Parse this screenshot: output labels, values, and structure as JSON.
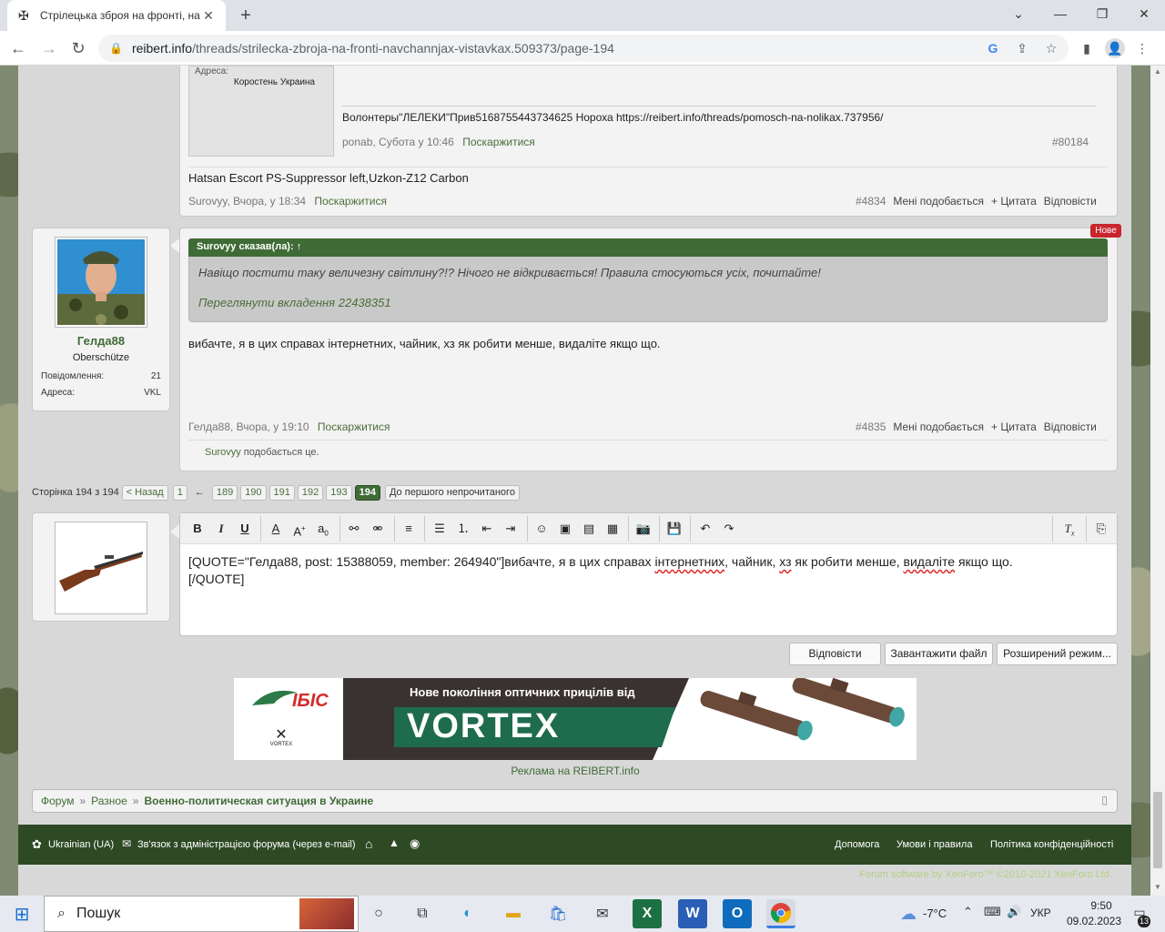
{
  "browser": {
    "tab_title": "Стрілецька зброя на фронті, нав",
    "url_host": "reibert.info",
    "url_path": "/threads/strilecka-zbroja-na-fronti-navchannjax-vistavkax.509373/page-194"
  },
  "prev_post": {
    "address_label": "Адреса:",
    "address_value": "Коростень Украина",
    "signature": "Волонтеры\"ЛЕЛЕКИ\"Прив5168755443734625 Нороха https://reibert.info/threads/pomosch-na-nolikax.737956/",
    "author_time": "ponab, Субота у 10:46",
    "report": "Поскаржитися",
    "number": "#80184",
    "message": "Hatsan Escort PS-Suppressor left,Uzkon-Z12 Carbon",
    "outer_author_time": "Surovyy, Вчора, у 18:34",
    "outer_report": "Поскаржитися",
    "outer_number": "#4834",
    "like": "Мені подобається",
    "quote": "+ Цитата",
    "reply": "Відповісти"
  },
  "post": {
    "badge_new": "Нове",
    "username": "Гелда88",
    "rank": "Oberschütze",
    "messages_label": "Повідомлення:",
    "messages_value": "21",
    "address_label": "Адреса:",
    "address_value": "VKL",
    "quote_header": "Surovyy сказав(ла): ↑",
    "quote_text": "Навіщо постити таку величезну світлину?!? Нічого не відкривається! Правила стосуються усіх, почитайте!",
    "quote_attachment": "Переглянути вкладення 22438351",
    "message": "вибачте, я в цих справах інтернетних, чайник, хз як робити менше, видаліте якщо що.",
    "author_time": "Гелда88, Вчора, у 19:10",
    "report": "Поскаржитися",
    "number": "#4835",
    "like": "Мені подобається",
    "quote": "+ Цитата",
    "reply": "Відповісти",
    "liked_user": "Surovyy",
    "liked_text": " подобається це."
  },
  "pager": {
    "label": "Сторінка 194 з 194",
    "prev": "< Назад",
    "first": "1",
    "gap": "←",
    "pages": [
      "189",
      "190",
      "191",
      "192",
      "193"
    ],
    "current": "194",
    "unread": "До першого непрочитаного"
  },
  "editor": {
    "text_a": "[QUOTE=\"Гелда88, post: 15388059, member: 264940\"]вибачте, я в цих справах ",
    "text_b": "інтернетних",
    "text_c": ", чайник, ",
    "text_d": "хз",
    "text_e": " як робити менше, ",
    "text_f": "видаліте",
    "text_g": "  якщо що.",
    "text_h": "[/QUOTE]"
  },
  "buttons": {
    "reply": "Відповісти",
    "upload": "Завантажити файл",
    "advanced": "Розширений режим..."
  },
  "ad": {
    "brand_ibis": "ІБІС",
    "headline": "Нове покоління оптичних прицілів від",
    "brand_vortex": "VORTEX",
    "vortex_small": "VORTEX",
    "caption": "Реклама на REIBERT.info"
  },
  "breadcrumbs": {
    "forum": "Форум",
    "sep1": "»",
    "misc": "Разное",
    "sep2": "»",
    "current": "Военно-политическая ситуация в Украине"
  },
  "footer": {
    "language": "Ukrainian (UA)",
    "contact": "Зв'язок з адміністрацією форума (через e-mail)",
    "help": "Допомога",
    "terms": "Умови і правила",
    "privacy": "Політика конфіденційності",
    "credit": "Forum software by XenForo™ ©2010-2021 XenForo Ltd."
  },
  "taskbar": {
    "search": "Пошук",
    "temp": "-7°C",
    "lang": "УКР",
    "time": "9:50",
    "date": "09.02.2023",
    "notif": "13"
  },
  "colors": {
    "forum_green": "#3f6b36",
    "link_green": "#4a6e3a",
    "new_badge": "#c8252d"
  }
}
